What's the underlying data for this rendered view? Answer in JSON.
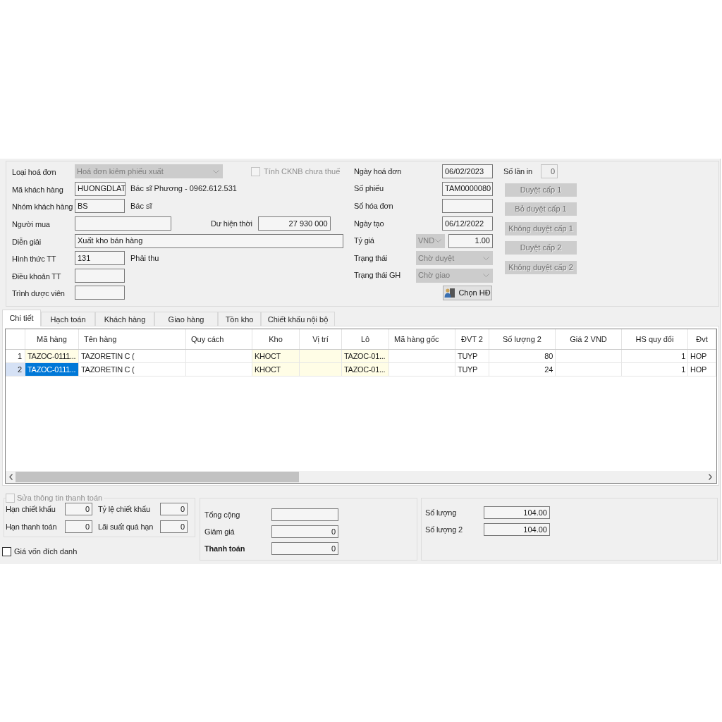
{
  "invoice": {
    "invoice_type": {
      "label": "Loại hoá đơn",
      "value": "Hoá đơn kiêm phiếu xuất",
      "disabled": true
    },
    "exclusive_tax_checkbox": {
      "label": "Tính CKNB chưa thuế",
      "checked": false,
      "disabled": true
    },
    "customer_code": {
      "label": "Mã khách hàng",
      "value": "HUONGDLAT",
      "note": "Bác sĩ Phương - 0962.612.531"
    },
    "customer_group": {
      "label": "Nhóm khách hàng",
      "value": "BS",
      "note": "Bác sĩ"
    },
    "buyer": {
      "label": "Người mua"
    },
    "current_balance": {
      "label": "Dư hiện thời",
      "value": "27 930 000"
    },
    "description": {
      "label": "Diễn giải",
      "value": "Xuất kho bán hàng"
    },
    "payment_method": {
      "label": "Hình thức TT",
      "value": "131",
      "note": "Phải thu"
    },
    "payment_terms": {
      "label": "Điều khoản TT"
    },
    "sales_rep": {
      "label": "Trình dược viên"
    },
    "invoice_date": {
      "label": "Ngày hoá đơn",
      "value": "06/02/2023"
    },
    "voucher_number": {
      "label": "Số phiếu",
      "value": "TAM0000080"
    },
    "invoice_number": {
      "label": "Số hóa đơn"
    },
    "created_date": {
      "label": "Ngày tạo",
      "value": "06/12/2022"
    },
    "exchange_rate": {
      "label": "Tỷ giá",
      "currency": "VND",
      "currency_disabled": true,
      "value": "1.00"
    },
    "status": {
      "label": "Trạng thái",
      "value": "Chờ duyệt",
      "disabled": true
    },
    "delivery_status": {
      "label": "Trạng thái GH",
      "value": "Chờ giao",
      "disabled": true
    },
    "pick_invoice_button": {
      "label": "Chọn HĐ"
    },
    "print_count": {
      "label": "Số lần in",
      "value": "0",
      "disabled": true
    },
    "approval_buttons": [
      {
        "label": "Duyệt cấp 1",
        "disabled": true
      },
      {
        "label": "Bỏ duyệt cấp 1",
        "disabled": true
      },
      {
        "label": "Không duyệt cấp 1",
        "disabled": true
      },
      {
        "label": "Duyệt cấp 2",
        "disabled": true
      },
      {
        "label": "Không duyệt cấp 2",
        "disabled": true
      }
    ]
  },
  "tabs": [
    {
      "label": "Chi tiết",
      "selected": true
    },
    {
      "label": "Hạch toán",
      "selected": false
    },
    {
      "label": "Khách hàng",
      "selected": false
    },
    {
      "label": "Giao hàng",
      "selected": false
    },
    {
      "label": "Tồn kho",
      "selected": false
    },
    {
      "label": "Chiết khấu nội bộ",
      "selected": false
    }
  ],
  "grid": {
    "columns": [
      {
        "label": "Mã hàng",
        "highlighted": true
      },
      {
        "label": "Tên hàng"
      },
      {
        "label": "Quy cách"
      },
      {
        "label": "Kho",
        "highlighted": true
      },
      {
        "label": "Vị trí",
        "highlighted": true
      },
      {
        "label": "Lô",
        "highlighted": true
      },
      {
        "label": "Mã hàng gốc"
      },
      {
        "label": "ĐVT 2"
      },
      {
        "label": "Số lượng 2"
      },
      {
        "label": "Giá 2 VND"
      },
      {
        "label": "HS quy đổi"
      },
      {
        "label": "Đvt"
      }
    ],
    "rows": [
      {
        "number": "1",
        "selected": false,
        "cells": [
          "TAZOC-0111...",
          "TAZORETIN C (",
          null,
          "KHOCT",
          null,
          "TAZOC-01...",
          null,
          "TUYP",
          "80",
          null,
          "1",
          "HOP"
        ]
      },
      {
        "number": "2",
        "selected": true,
        "cells": [
          "TAZOC-0111...",
          "TAZORETIN C (",
          null,
          "KHOCT",
          null,
          "TAZOC-01...",
          null,
          "TUYP",
          "24",
          null,
          "1",
          "HOP"
        ]
      }
    ]
  },
  "payment_info": {
    "edit_checkbox": {
      "label": "Sửa thông tin thanh toán",
      "checked": false,
      "disabled": true
    },
    "fields": [
      {
        "label": "Hạn chiết khấu",
        "value": "0"
      },
      {
        "label": "Tỷ lệ chiết khấu",
        "value": "0"
      },
      {
        "label": "Hạn thanh toán",
        "value": "0"
      },
      {
        "label": "Lãi suất quá hạn",
        "value": "0"
      }
    ]
  },
  "specific_cost_checkbox": {
    "label": "Giá vốn đích danh",
    "checked": false
  },
  "totals": [
    {
      "kind": "line",
      "label": "Tổng cộng"
    },
    {
      "kind": "line",
      "label": "Giảm giá",
      "value": "0"
    },
    {
      "kind": "grand_total",
      "label": "Thanh toán",
      "value": "0"
    }
  ],
  "quantities": [
    {
      "label": "Số lượng",
      "value": "104.00"
    },
    {
      "label": "Số lượng 2",
      "value": "104.00"
    }
  ]
}
